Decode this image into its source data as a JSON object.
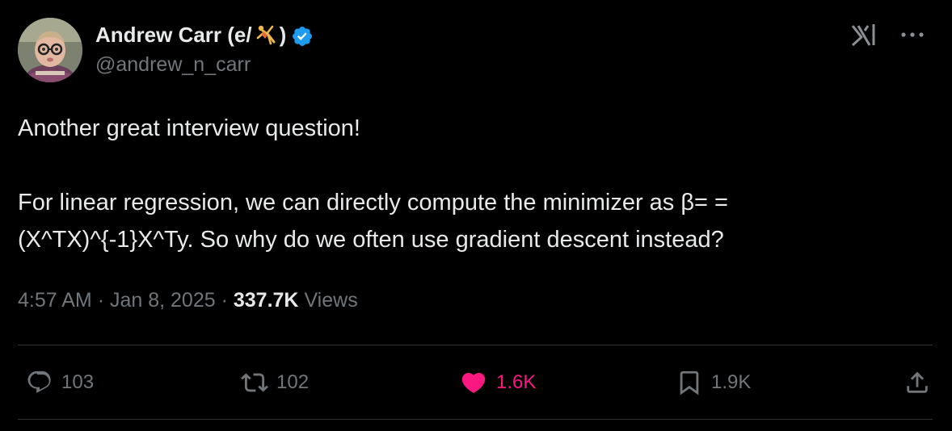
{
  "author": {
    "display_name": "Andrew Carr (e/",
    "display_name_end": ")",
    "emoji_name": "person-doing-cartwheel-icon",
    "handle": "@andrew_n_carr",
    "verified": true
  },
  "header_icons": [
    "grok-icon",
    "more-icon"
  ],
  "tweet": {
    "line1": "Another great interview question!",
    "line2": "For linear regression, we can directly compute the minimizer as β= =",
    "line3": "(X^TX)^{-1}X^Ty. So why do we often use gradient descent instead?"
  },
  "meta": {
    "time": "4:57 AM",
    "sep1": "·",
    "date": "Jan 8, 2025",
    "sep2": "·",
    "views_count": "337.7K",
    "views_label": "Views"
  },
  "actions": {
    "replies": "103",
    "reposts": "102",
    "likes": "1.6K",
    "bookmarks": "1.9K"
  },
  "colors": {
    "background": "#000000",
    "text": "#e7e9ea",
    "secondary": "#71767b",
    "verified": "#1d9bf0",
    "like": "#f91880",
    "divider": "#2f3336"
  }
}
